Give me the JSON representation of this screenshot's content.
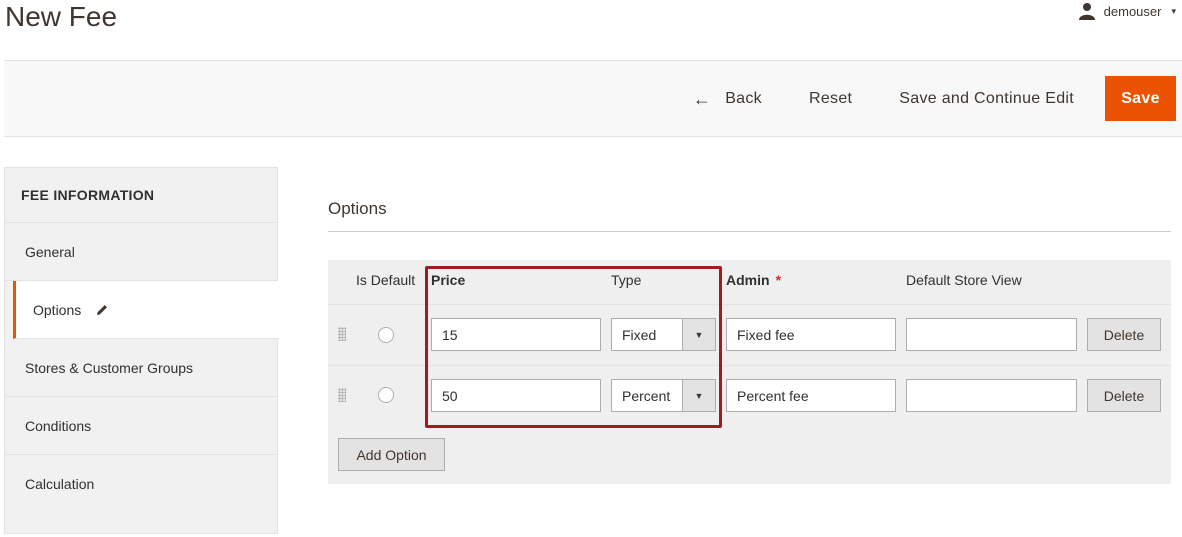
{
  "page": {
    "title": "New Fee"
  },
  "user": {
    "name": "demouser",
    "caret": "▾"
  },
  "actions": {
    "back_icon": "←",
    "back_label": "Back",
    "reset_label": "Reset",
    "save_continue_label": "Save and Continue Edit",
    "save_label": "Save"
  },
  "sidebar": {
    "title": "FEE INFORMATION",
    "items": [
      {
        "label": "General"
      },
      {
        "label": "Options"
      },
      {
        "label": "Stores & Customer Groups"
      },
      {
        "label": "Conditions"
      },
      {
        "label": "Calculation"
      }
    ]
  },
  "section": {
    "title": "Options"
  },
  "table": {
    "headers": {
      "is_default": "Is Default",
      "price": "Price",
      "type": "Type",
      "admin": "Admin",
      "required_mark": "*",
      "default_store_view": "Default Store View"
    },
    "rows": [
      {
        "price": "15",
        "type": "Fixed",
        "admin": "Fixed fee",
        "store_view": "",
        "delete_label": "Delete"
      },
      {
        "price": "50",
        "type": "Percent",
        "admin": "Percent fee",
        "store_view": "",
        "delete_label": "Delete"
      }
    ],
    "select_caret": "▼",
    "add_option_label": "Add Option"
  },
  "colors": {
    "accent": "#eb5202",
    "highlight": "#a61a1f"
  }
}
